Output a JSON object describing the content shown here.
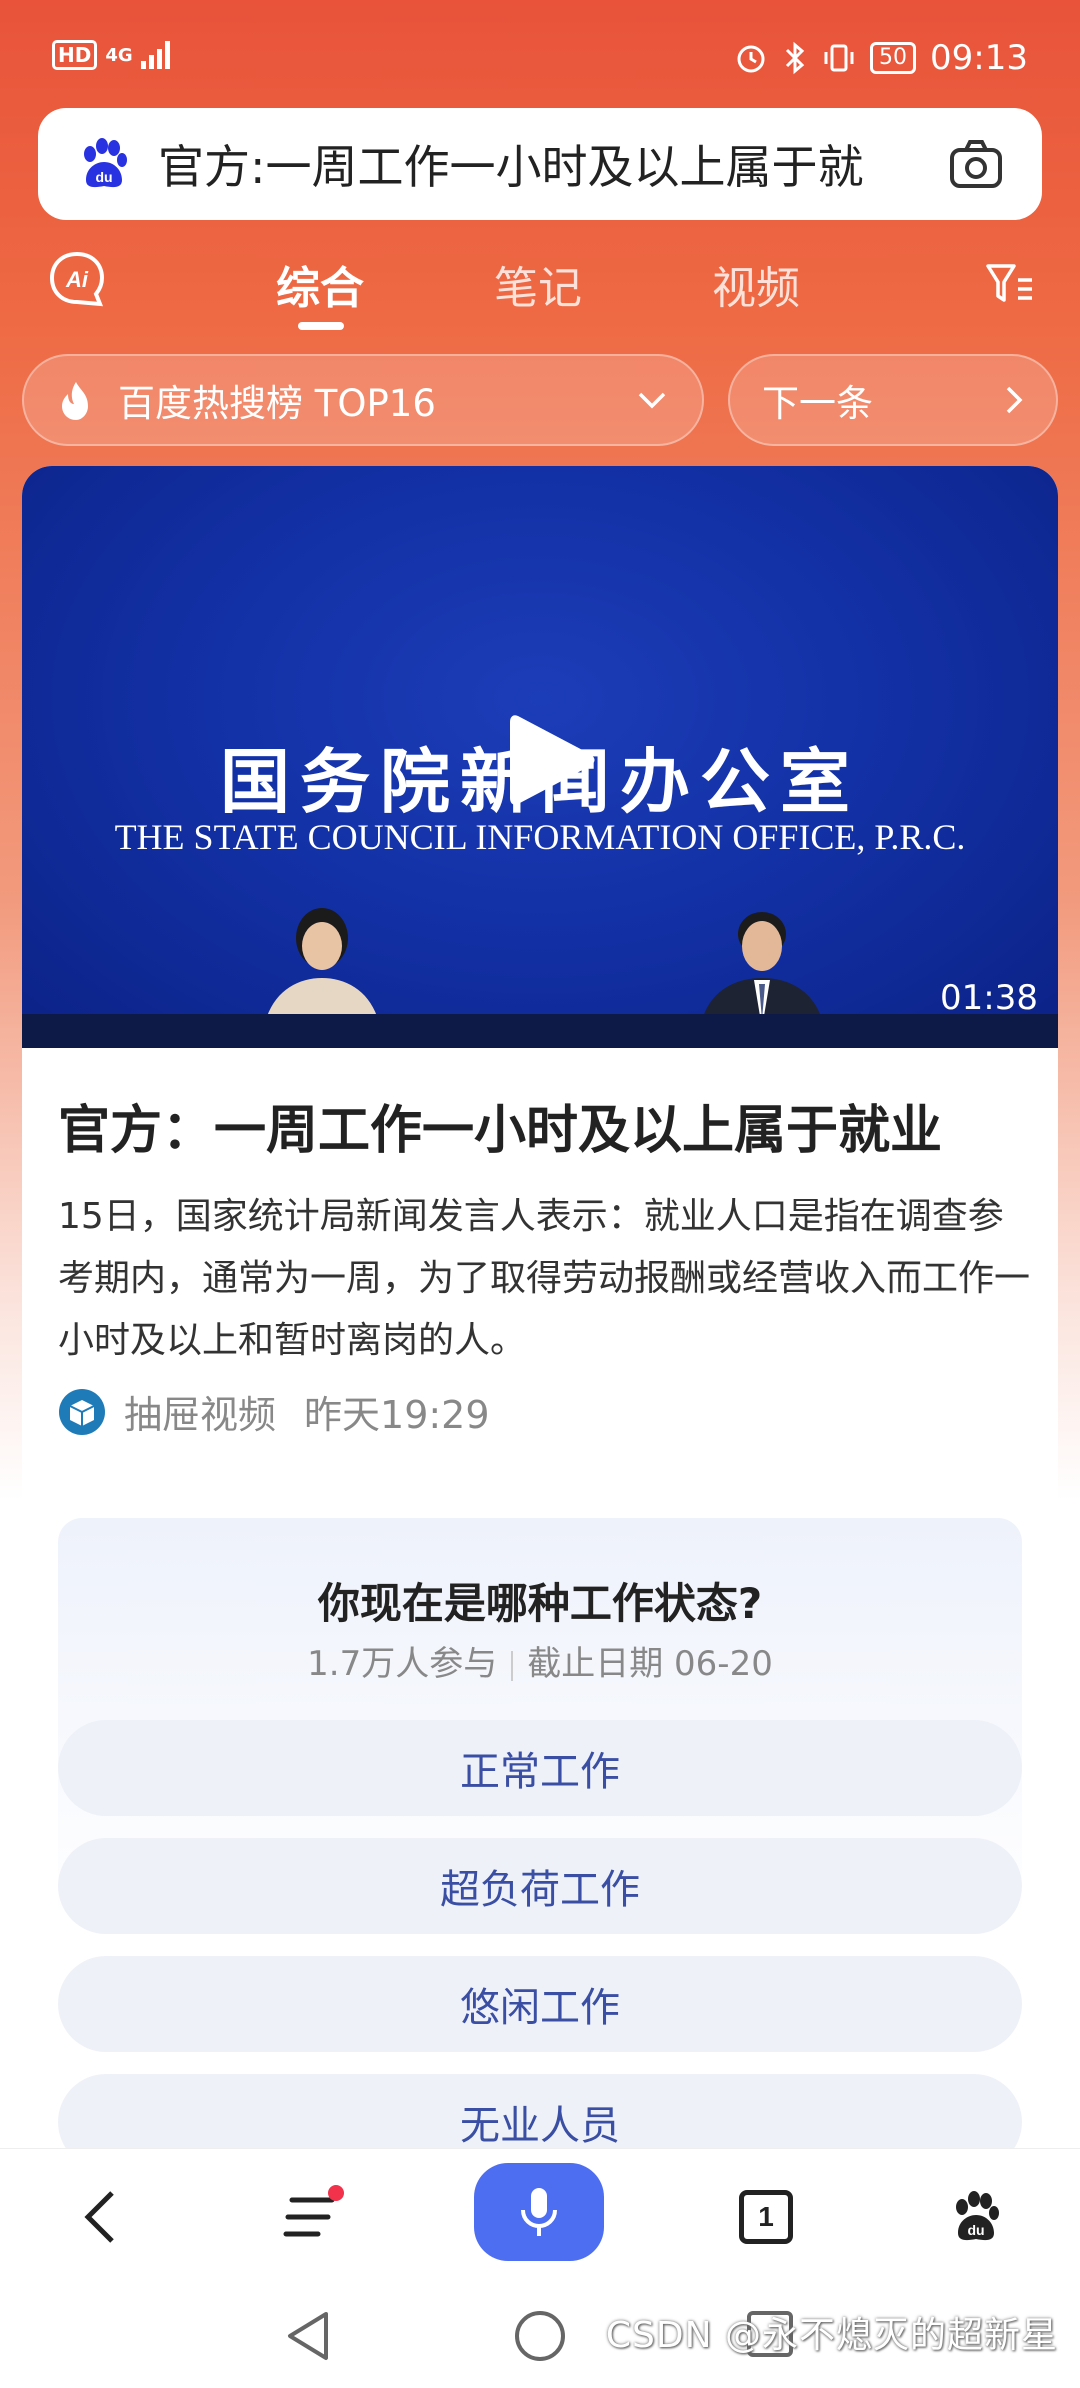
{
  "status_bar": {
    "hd_label": "HD",
    "network": "4G",
    "battery": "50",
    "time": "09:13"
  },
  "search": {
    "query": "官方:一周工作一小时及以上属于就"
  },
  "tabs": [
    {
      "label": "综合",
      "active": true
    },
    {
      "label": "笔记",
      "active": false
    },
    {
      "label": "视频",
      "active": false
    }
  ],
  "hot_list": {
    "label": "百度热搜榜 TOP16",
    "next_label": "下一条"
  },
  "video": {
    "title_cn": "国务院新闻办公室",
    "title_en": "THE STATE COUNCIL INFORMATION OFFICE, P.R.C.",
    "duration": "01:38"
  },
  "article": {
    "title": "官方：一周工作一小时及以上属于就业",
    "description": "15日，国家统计局新闻发言人表示：就业人口是指在调查参考期内，通常为一周，为了取得劳动报酬或经营收入而工作一小时及以上和暂时离岗的人。",
    "source": "抽屉视频",
    "time": "昨天19:29"
  },
  "poll": {
    "question": "你现在是哪种工作状态?",
    "participants": "1.7万人参与",
    "deadline": "截止日期 06-20",
    "options": [
      "正常工作",
      "超负荷工作",
      "悠闲工作",
      "无业人员"
    ]
  },
  "bottom_nav": {
    "tab_count": "1"
  },
  "watermark": "CSDN @永不熄灭的超新星",
  "colors": {
    "accent": "#4e6ef2",
    "header_red": "#e8533a",
    "poll_text": "#3a4fa3"
  }
}
